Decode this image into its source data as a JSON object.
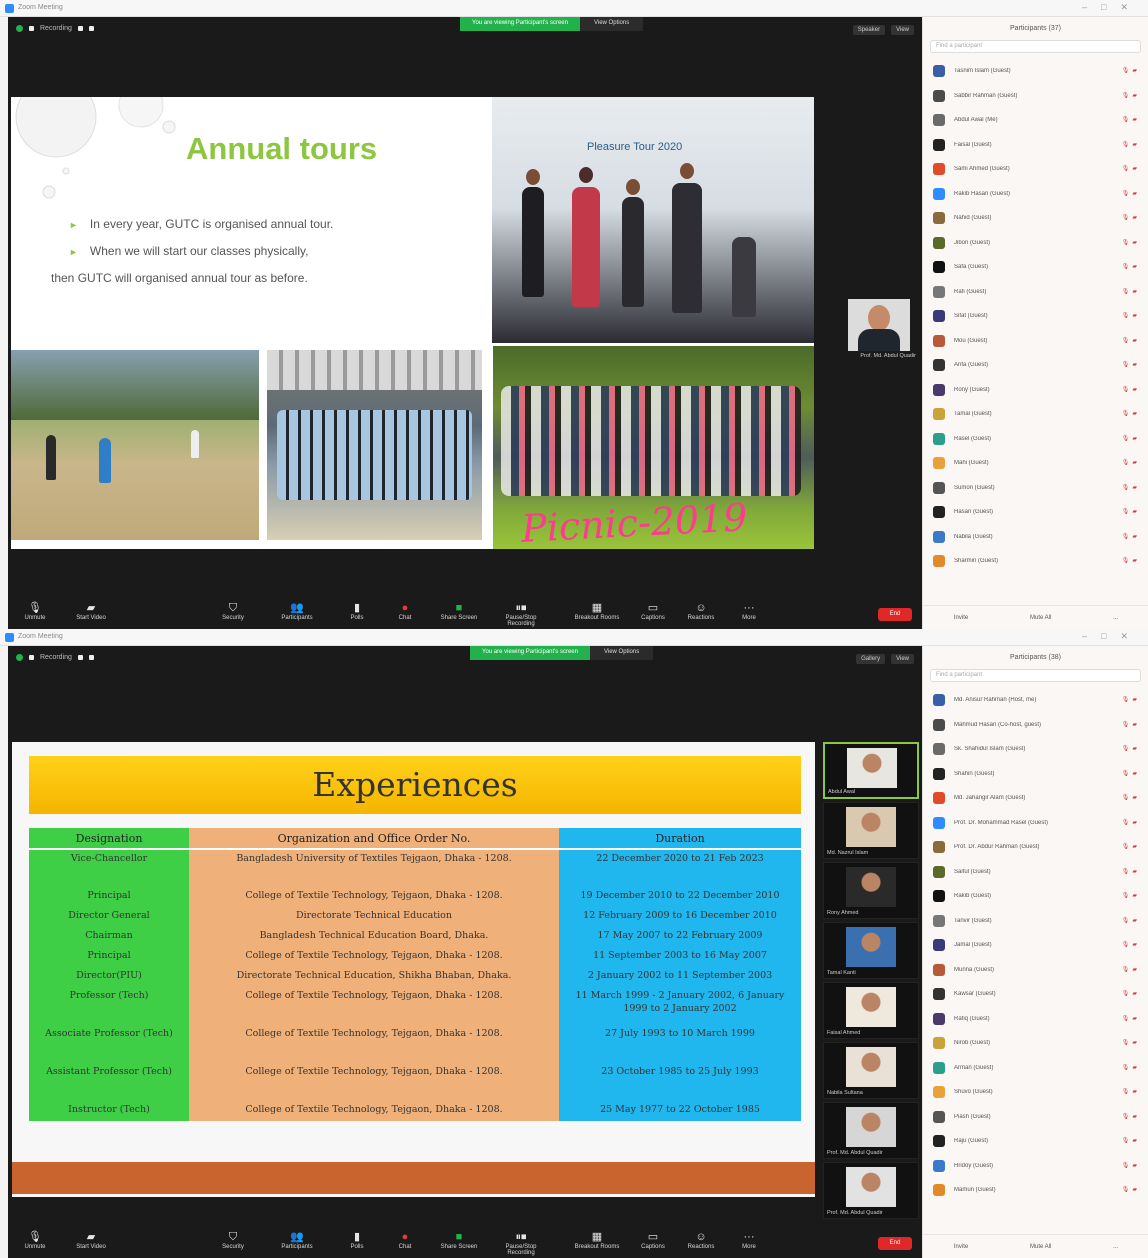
{
  "screenshot1": {
    "window_title": "Zoom Meeting",
    "share_banner": {
      "status": "You are viewing Participant's screen",
      "action": "View Options"
    },
    "top_left": {
      "label": "Recording"
    },
    "top_right": {
      "view": "Speaker",
      "more": "View"
    },
    "slide": {
      "title": "Annual tours",
      "bullets": [
        "In every year, GUTC is organised annual tour.",
        "When we will start our classes physically,",
        "then GUTC will organised annual tour as before."
      ],
      "stage_banner": "Pleasure Tour 2020",
      "picnic_caption": "Picnic-2019"
    },
    "self_view_label": "Prof. Md. Abdul Quadir",
    "toolbar": [
      {
        "icon": "microphone-icon",
        "label": "Unmute"
      },
      {
        "icon": "video-camera-icon",
        "label": "Start Video"
      },
      {
        "icon": "shield-icon",
        "label": "Security"
      },
      {
        "icon": "participants-icon",
        "label": "Participants"
      },
      {
        "icon": "poll-icon",
        "label": "Polls"
      },
      {
        "icon": "chat-icon",
        "label": "Chat"
      },
      {
        "icon": "share-screen-icon",
        "label": "Share Screen"
      },
      {
        "icon": "record-icon",
        "label": "Pause/Stop Recording"
      },
      {
        "icon": "breakout-icon",
        "label": "Breakout Rooms"
      },
      {
        "icon": "caption-icon",
        "label": "Captions"
      },
      {
        "icon": "reactions-icon",
        "label": "Reactions"
      },
      {
        "icon": "more-icon",
        "label": "More"
      }
    ],
    "end_label": "End",
    "sidebar": {
      "title": "Participants (37)",
      "search_placeholder": "Find a participant",
      "participants": [
        "Tasnim Islam (Guest)",
        "Sabbir Rahman (Guest)",
        "Abdul Awal (Me)",
        "Faisal (Guest)",
        "Sami Ahmed (Guest)",
        "Rakib Hasan (Guest)",
        "Nahid (Guest)",
        "Jibon (Guest)",
        "Safa (Guest)",
        "Rafi (Guest)",
        "Sifat (Guest)",
        "Mou (Guest)",
        "Arifa (Guest)",
        "Rony (Guest)",
        "Tamal (Guest)",
        "Rasel (Guest)",
        "Mahi (Guest)",
        "Sumon (Guest)",
        "Hasan (Guest)",
        "Nabila (Guest)",
        "Sharmin (Guest)"
      ],
      "footer": [
        "Invite",
        "Mute All",
        "..."
      ]
    }
  },
  "screenshot2": {
    "window_title": "Zoom Meeting",
    "share_banner": {
      "status": "You are viewing Participant's screen",
      "action": "View Options"
    },
    "top_left": {
      "label": "Recording"
    },
    "top_right": {
      "view": "Gallery",
      "more": "View"
    },
    "slide": {
      "title": "Experiences",
      "headers": [
        "Designation",
        "Organization and Office Order No.",
        "Duration"
      ],
      "rows": [
        [
          "Vice-Chancellor",
          "Bangladesh University of Textiles Tejgaon, Dhaka - 1208.",
          "22 December 2020 to 21 Feb 2023"
        ],
        [
          "Principal",
          "College of Textile Technology, Tejgaon, Dhaka - 1208.",
          "19 December 2010 to 22 December 2010"
        ],
        [
          "Director General",
          "Directorate Technical Education",
          "12 February 2009 to 16 December 2010"
        ],
        [
          "Chairman",
          "Bangladesh Technical Education Board, Dhaka.",
          "17 May 2007 to 22 February 2009"
        ],
        [
          "Principal",
          "College of Textile Technology, Tejgaon, Dhaka - 1208.",
          "11 September 2003 to 16 May 2007"
        ],
        [
          "Director(PIU)",
          "Directorate Technical Education, Shikha Bhaban, Dhaka.",
          "2 January 2002 to 11 September 2003"
        ],
        [
          "Professor (Tech)",
          "College of Textile Technology, Tejgaon, Dhaka - 1208.",
          "11 March 1999 - 2 January 2002, 6 January 1999 to 2 January 2002"
        ],
        [
          "Associate Professor (Tech)",
          "College of Textile Technology, Tejgaon, Dhaka - 1208.",
          "27 July 1993 to 10 March 1999"
        ],
        [
          "Assistant Professor (Tech)",
          "College of Textile Technology, Tejgaon, Dhaka - 1208.",
          "23 October 1985 to 25 July 1993"
        ],
        [
          "Instructor (Tech)",
          "College of Textile Technology, Tejgaon, Dhaka - 1208.",
          "25 May 1977 to 22 October 1985"
        ]
      ]
    },
    "gallery": [
      "Abdul Awal",
      "Md. Nazrul Islam",
      "Rony Ahmed",
      "Tamal Kanti",
      "Faisal Ahmed",
      "Nabila Sultana",
      "Prof. Md. Abdul Quadir",
      "Prof. Md. Abdul Quadir"
    ],
    "toolbar": [
      {
        "icon": "microphone-icon",
        "label": "Unmute"
      },
      {
        "icon": "video-camera-icon",
        "label": "Start Video"
      },
      {
        "icon": "shield-icon",
        "label": "Security"
      },
      {
        "icon": "participants-icon",
        "label": "Participants"
      },
      {
        "icon": "poll-icon",
        "label": "Polls"
      },
      {
        "icon": "chat-icon",
        "label": "Chat"
      },
      {
        "icon": "share-screen-icon",
        "label": "Share Screen"
      },
      {
        "icon": "record-icon",
        "label": "Pause/Stop Recording"
      },
      {
        "icon": "breakout-icon",
        "label": "Breakout Rooms"
      },
      {
        "icon": "caption-icon",
        "label": "Captions"
      },
      {
        "icon": "reactions-icon",
        "label": "Reactions"
      },
      {
        "icon": "more-icon",
        "label": "More"
      }
    ],
    "end_label": "End",
    "sidebar": {
      "title": "Participants (38)",
      "search_placeholder": "Find a participant",
      "participants": [
        "Md. Anisur Rahman (Host, me)",
        "Mahmud Hasan (Co-host, guest)",
        "Sk. Shahidul Islam (Guest)",
        "Shahin (Guest)",
        "Md. Jahangir Alam (Guest)",
        "Prof. Dr. Mohammad Rasel (Guest)",
        "Prof. Dr. Abdur Rahman (Guest)",
        "Saiful (Guest)",
        "Rakib (Guest)",
        "Tanvir (Guest)",
        "Jamal (Guest)",
        "Munna (Guest)",
        "Kawsar (Guest)",
        "Rafiq (Guest)",
        "Nirob (Guest)",
        "Arman (Guest)",
        "Shuvo (Guest)",
        "Piash (Guest)",
        "Raju (Guest)",
        "Hridoy (Guest)",
        "Mamun (Guest)"
      ],
      "footer": [
        "Invite",
        "Mute All",
        "..."
      ]
    }
  },
  "colors": {
    "zoom_blue": "#2d8cff",
    "banner_green": "#23b14d",
    "end_red": "#e02828",
    "slide_green": "#8dc63f",
    "designation_green": "#3fcf47",
    "organization_orange": "#f0b07a",
    "duration_blue": "#1fb7ee",
    "title_yellow": "#f5b400"
  }
}
